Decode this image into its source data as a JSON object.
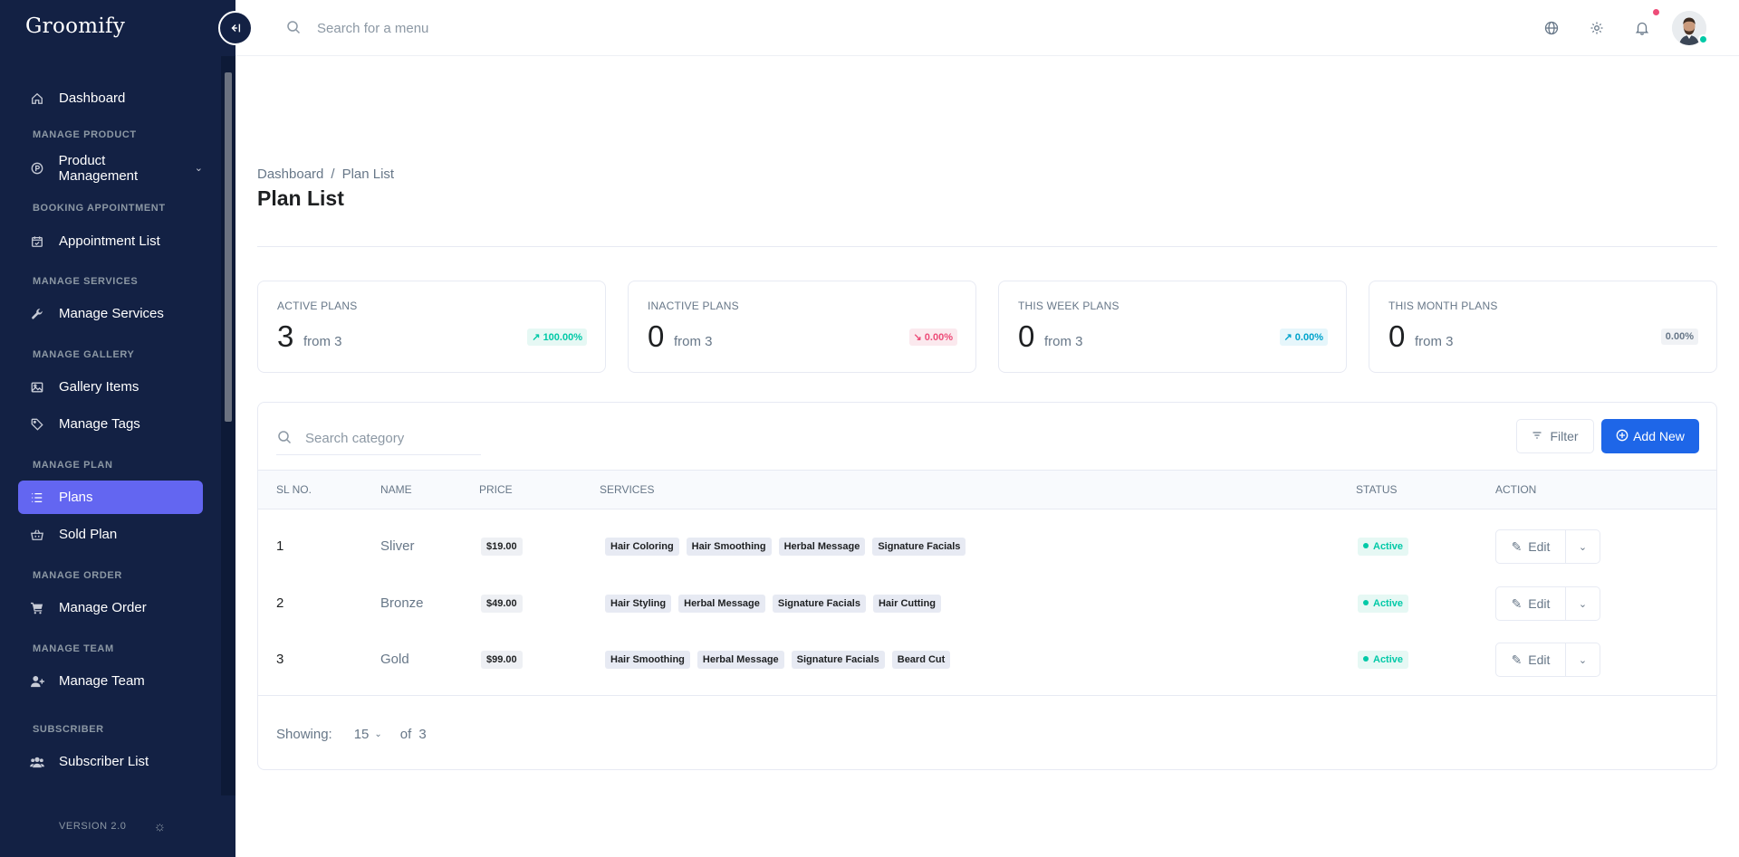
{
  "app": {
    "brand": "Groomify"
  },
  "sidebar": {
    "items": [
      {
        "label": "Dashboard",
        "icon": "home-icon"
      },
      {
        "section": "MANAGE PRODUCT"
      },
      {
        "label": "Product Management",
        "icon": "product-icon",
        "has_submenu": true
      },
      {
        "section": "BOOKING APPOINTMENT"
      },
      {
        "label": "Appointment List",
        "icon": "calendar-check-icon"
      },
      {
        "section": "MANAGE SERVICES"
      },
      {
        "label": "Manage Services",
        "icon": "wrench-icon"
      },
      {
        "section": "MANAGE GALLERY"
      },
      {
        "label": "Gallery Items",
        "icon": "image-icon"
      },
      {
        "label": "Manage Tags",
        "icon": "tag-icon"
      },
      {
        "section": "MANAGE PLAN"
      },
      {
        "label": "Plans",
        "icon": "list-icon",
        "active": true
      },
      {
        "label": "Sold Plan",
        "icon": "basket-icon"
      },
      {
        "section": "MANAGE ORDER"
      },
      {
        "label": "Manage Order",
        "icon": "cart-icon"
      },
      {
        "section": "MANAGE TEAM"
      },
      {
        "label": "Manage Team",
        "icon": "user-plus-icon"
      },
      {
        "section": "SUBSCRIBER"
      },
      {
        "label": "Subscriber List",
        "icon": "users-icon"
      }
    ],
    "version": "VERSION 2.0"
  },
  "header": {
    "search_placeholder": "Search for a menu"
  },
  "page": {
    "breadcrumb": [
      "Dashboard",
      "Plan List"
    ],
    "title": "Plan List"
  },
  "stats": [
    {
      "label": "ACTIVE PLANS",
      "value": "3",
      "from": "from 3",
      "change": "100.00%",
      "trend": "up"
    },
    {
      "label": "INACTIVE PLANS",
      "value": "0",
      "from": "from 3",
      "change": "0.00%",
      "trend": "down"
    },
    {
      "label": "THIS WEEK PLANS",
      "value": "0",
      "from": "from 3",
      "change": "0.00%",
      "trend": "teal"
    },
    {
      "label": "THIS MONTH PLANS",
      "value": "0",
      "from": "from 3",
      "change": "0.00%",
      "trend": "flat"
    }
  ],
  "table": {
    "search_placeholder": "Search category",
    "filter_label": "Filter",
    "add_label": "Add New",
    "columns": [
      "SL NO.",
      "NAME",
      "PRICE",
      "SERVICES",
      "STATUS",
      "ACTION"
    ],
    "rows": [
      {
        "sl": "1",
        "name": "Sliver",
        "price": "$19.00",
        "services": [
          "Hair Coloring",
          "Hair Smoothing",
          "Herbal Message",
          "Signature Facials"
        ],
        "status": "Active",
        "action": "Edit"
      },
      {
        "sl": "2",
        "name": "Bronze",
        "price": "$49.00",
        "services": [
          "Hair Styling",
          "Herbal Message",
          "Signature Facials",
          "Hair Cutting"
        ],
        "status": "Active",
        "action": "Edit"
      },
      {
        "sl": "3",
        "name": "Gold",
        "price": "$99.00",
        "services": [
          "Hair Smoothing",
          "Herbal Message",
          "Signature Facials",
          "Beard Cut"
        ],
        "status": "Active",
        "action": "Edit"
      }
    ],
    "footer": {
      "showing_label": "Showing:",
      "page_size": "15",
      "of_label": "of",
      "total": "3"
    }
  }
}
